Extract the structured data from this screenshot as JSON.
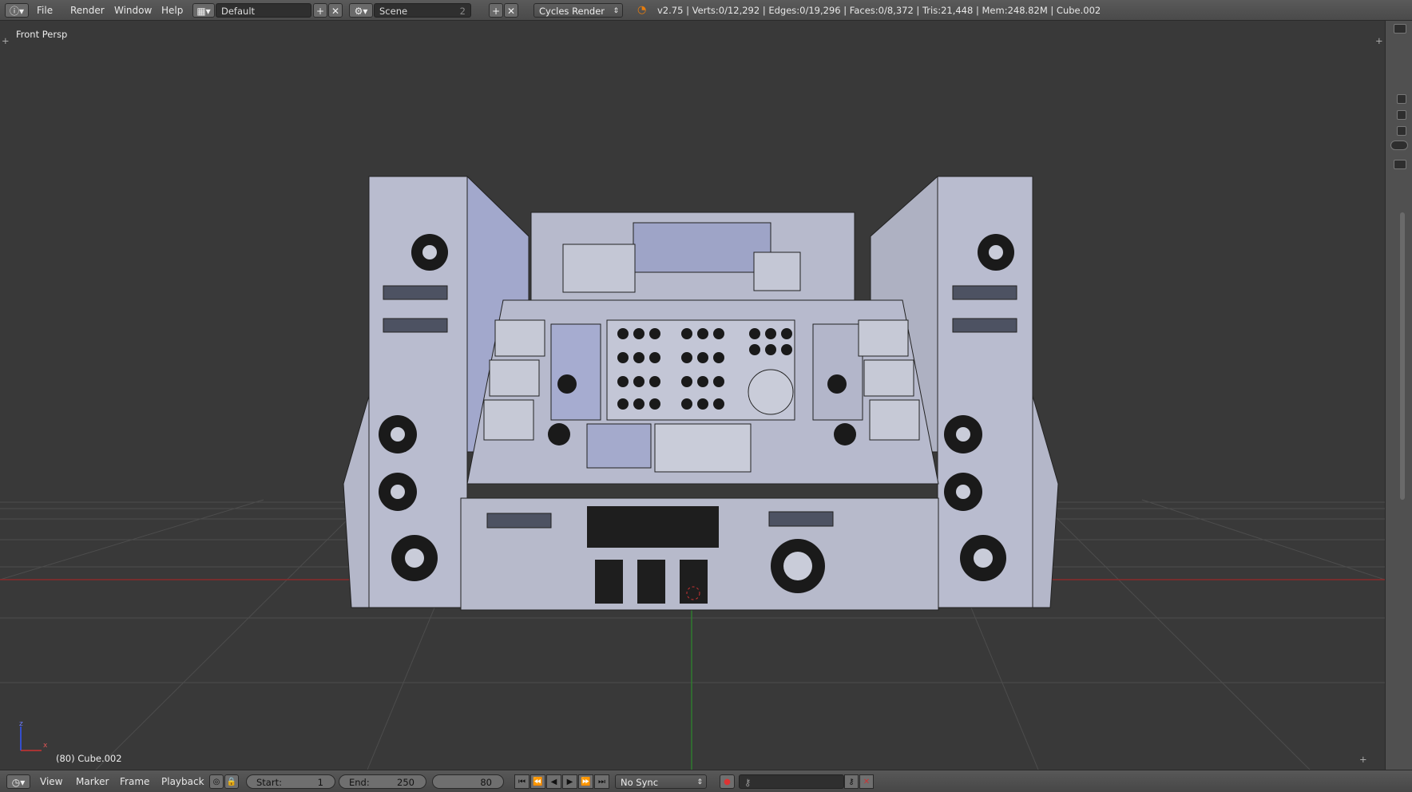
{
  "topbar": {
    "menus": [
      "File",
      "Render",
      "Window",
      "Help"
    ],
    "screen_layout": "Default",
    "scene_name": "Scene",
    "scene_users": "2",
    "render_engine": "Cycles Render",
    "stats": "v2.75 | Verts:0/12,292 | Edges:0/19,296 | Faces:0/8,372 | Tris:21,448 | Mem:248.82M | Cube.002"
  },
  "viewport": {
    "view_label": "Front Persp",
    "object_label": "(80) Cube.002",
    "axis_x": "x",
    "axis_z": "z"
  },
  "timeline": {
    "menus": [
      "View",
      "Marker",
      "Frame",
      "Playback"
    ],
    "start_label": "Start:",
    "start_value": "1",
    "end_label": "End:",
    "end_value": "250",
    "current_frame": "80",
    "sync": "No Sync"
  },
  "colors": {
    "ui_bg": "#4a4a4a",
    "viewport_bg": "#393939",
    "grid": "#555555",
    "x_axis": "#8a2a2a",
    "y_axis": "#2f7a2f",
    "model_fill": "#b8bcd2",
    "model_dark": "#1a1a1a"
  }
}
